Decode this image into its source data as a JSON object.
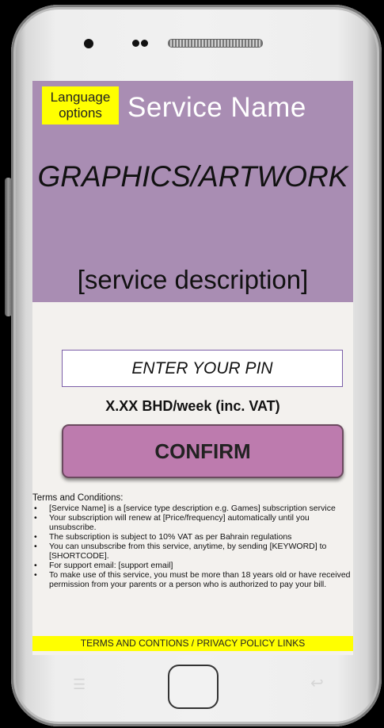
{
  "hero": {
    "language_button": "Language options",
    "service_name": "Service Name",
    "graphics_placeholder": "GRAPHICS/ARTWORK",
    "service_description": "[service description]"
  },
  "form": {
    "pin_placeholder": "ENTER YOUR PIN",
    "price": "X.XX BHD/week (inc. VAT)",
    "confirm_label": "CONFIRM"
  },
  "terms": {
    "title": "Terms and Conditions:",
    "items": [
      "[Service Name] is a [service type description e.g. Games] subscription service",
      "Your subscription will renew at [Price/frequency] automatically until you unsubscribe.",
      "The subscription is subject to 10% VAT as per Bahrain regulations",
      "You can unsubscribe from this service, anytime, by sending [KEYWORD] to [SHORTCODE].",
      "For support email: [support email]",
      "To make use of this service, you must be more than 18 years old or have received permission from your parents or a person who is authorized to pay your bill."
    ],
    "links": "TERMS AND CONTIONS / PRIVACY POLICY LINKS"
  },
  "device": {
    "menu_icon": "menu-icon",
    "back_icon": "back-arrow-icon",
    "home_icon": "home-button-icon"
  },
  "colors": {
    "hero_bg": "#a98db3",
    "highlight": "#ffff00",
    "confirm_bg": "#bd7bae",
    "screen_bg": "#f3f1ee"
  }
}
